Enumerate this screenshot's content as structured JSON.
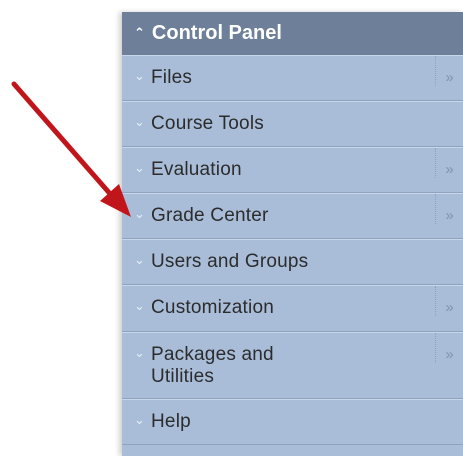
{
  "panel": {
    "title": "Control Panel",
    "header_icon": "double-chevron-up-icon",
    "items": [
      {
        "label": "Files",
        "has_expand": true
      },
      {
        "label": "Course Tools",
        "has_expand": false
      },
      {
        "label": "Evaluation",
        "has_expand": true
      },
      {
        "label": "Grade Center",
        "has_expand": true
      },
      {
        "label": "Users and Groups",
        "has_expand": false
      },
      {
        "label": "Customization",
        "has_expand": true
      },
      {
        "label": "Packages and Utilities",
        "has_expand": true
      },
      {
        "label": "Help",
        "has_expand": false
      }
    ]
  },
  "glyphs": {
    "header_chevron": "≈",
    "item_chevron": "»",
    "expand": "»"
  },
  "colors": {
    "header_bg": "#6d7f99",
    "panel_bg": "#a9bdd9",
    "arrow": "#c0161b"
  },
  "annotation": {
    "type": "arrow",
    "points_to": "Grade Center"
  }
}
